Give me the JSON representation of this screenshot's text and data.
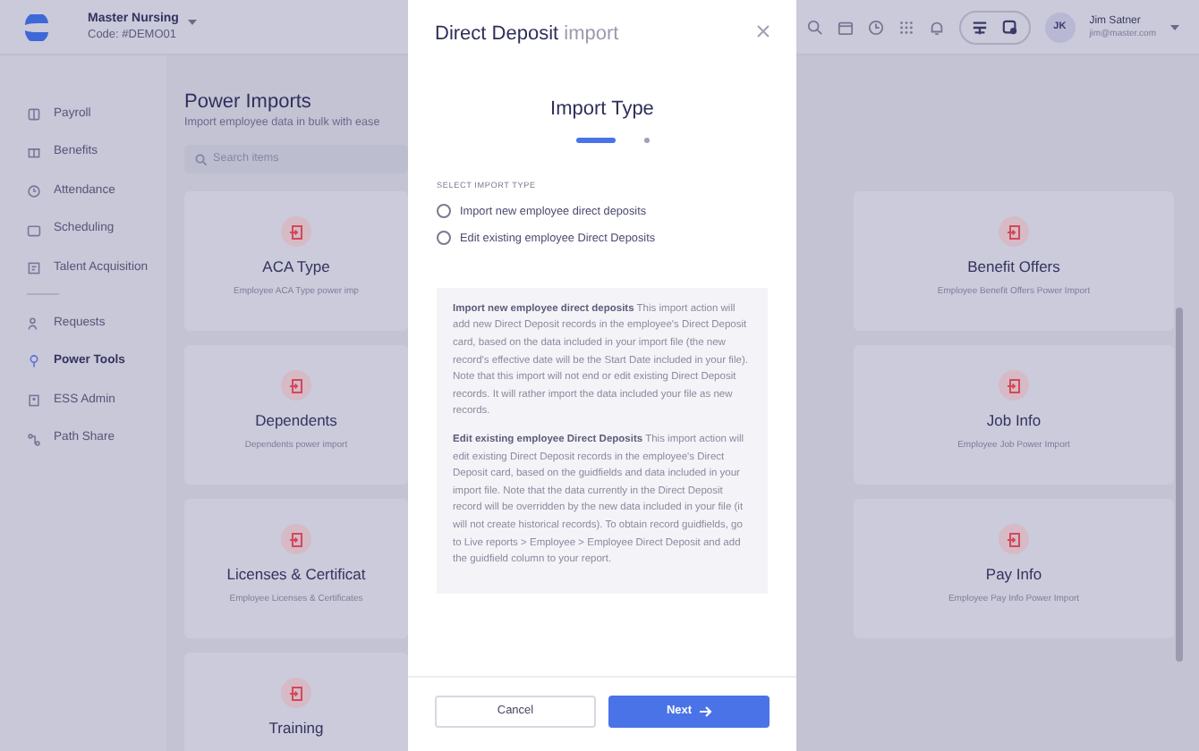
{
  "app": {
    "company": "Master Nursing",
    "code": "Code: #DEMO01"
  },
  "header": {
    "user": {
      "initials": "JK",
      "name": "Jim Satner",
      "email": "jim@master.com"
    }
  },
  "sidebar": {
    "groups": [
      [
        {
          "label": "Payroll",
          "selected": false
        },
        {
          "label": "Benefits",
          "selected": false
        },
        {
          "label": "Attendance",
          "selected": false
        },
        {
          "label": "Scheduling",
          "selected": false
        },
        {
          "label": "Talent Acquisition",
          "selected": false
        }
      ],
      [
        {
          "label": "Requests",
          "selected": false
        },
        {
          "label": "Power Tools",
          "selected": true
        },
        {
          "label": "ESS Admin",
          "selected": false
        },
        {
          "label": "Path Share",
          "selected": false
        }
      ]
    ]
  },
  "page": {
    "title": "Power Imports",
    "subtitle": "Import employee data in bulk with ease",
    "search": {
      "placeholder": "Search items"
    },
    "columns": [
      [
        {
          "title": "ACA Type",
          "description": "Employee ACA Type power imp"
        },
        {
          "title": "Dependents",
          "description": "Dependents power import"
        },
        {
          "title": "Licenses & Certificat",
          "description": "Employee Licenses & Certificates"
        },
        {
          "title": "Training"
        }
      ],
      [
        {
          "title": "Benefit Offers",
          "description": "Employee Benefit Offers Power Import"
        },
        {
          "title": "Job Info",
          "description": "Employee Job Power Import"
        },
        {
          "title": "Pay Info",
          "description": "Employee Pay Info Power Import"
        }
      ]
    ]
  },
  "modal": {
    "title": "Direct Deposit",
    "title_suffix": "import",
    "step_title": "Import Type",
    "steps": [
      {
        "selected": true
      },
      {
        "selected": false
      }
    ],
    "section_label": "SELECT IMPORT TYPE",
    "options": [
      {
        "label": "Import new employee direct deposits",
        "selected": false
      },
      {
        "label": "Edit existing employee Direct Deposits",
        "selected": false
      }
    ],
    "info": [
      {
        "heading": "Import new employee direct deposits",
        "text": "This import action will add new Direct Deposit records in the employee's Direct Deposit card, based on the data included in your import file (the new record's effective date will be the Start Date included in your file). Note that this import will not end or edit existing Direct Deposit records. It will rather import the data included your file as new records."
      },
      {
        "heading": "Edit existing employee Direct Deposits",
        "text": "This import action will edit existing Direct Deposit records in the employee's Direct Deposit card, based on the guidfields and data included in your import file. Note that the data currently in the Direct Deposit record will be overridden by the new data included in your file (it will not create historical records). To obtain record guidfields, go to Live reports > Employee > Employee Direct Deposit and add the guidfield column to your report."
      }
    ],
    "buttons": {
      "cancel": "Cancel",
      "next": "Next"
    }
  }
}
